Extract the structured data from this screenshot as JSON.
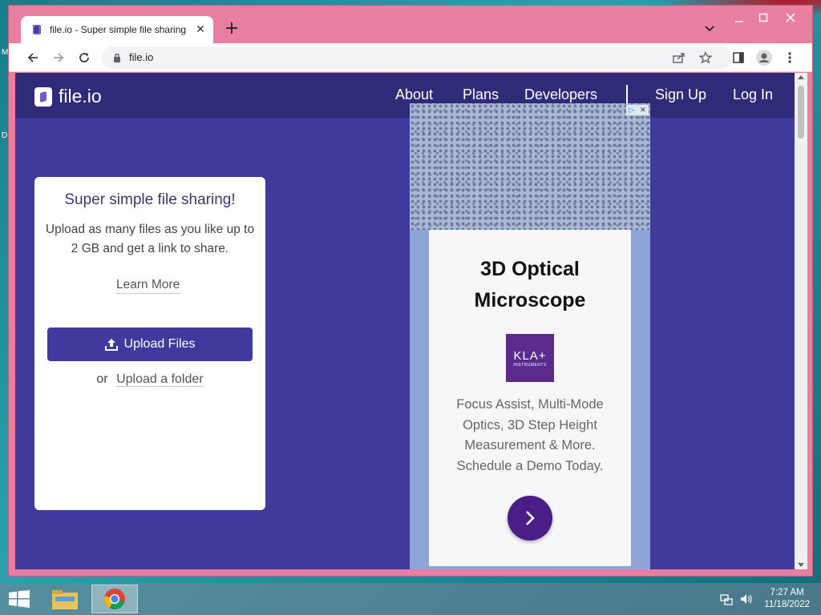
{
  "desktop": {
    "labels": [
      "M",
      "D"
    ]
  },
  "browser": {
    "tab_title": "file.io - Super simple file sharing",
    "url": "file.io",
    "accent": "#e87ea0"
  },
  "site": {
    "logo_text": "file.io",
    "nav": [
      "About",
      "Plans",
      "Developers",
      "Sign Up",
      "Log In"
    ],
    "bg_color": "#3f3a9b",
    "nav_color": "#302b79"
  },
  "card": {
    "heading": "Super simple file sharing!",
    "description": "Upload as many files as you like up to 2 GB and get a link to share.",
    "learn_more": "Learn More",
    "upload_button": "Upload Files",
    "or_text": "or",
    "upload_folder": "Upload a folder"
  },
  "ad": {
    "title": "3D Optical Microscope",
    "logo_main": "KLA+",
    "logo_sub": "INSTRUMENTS",
    "body": "Focus Assist, Multi-Mode Optics, 3D Step Height Measurement & More. Schedule a Demo Today."
  },
  "taskbar": {
    "time": "7:27 AM",
    "date": "11/18/2022"
  }
}
